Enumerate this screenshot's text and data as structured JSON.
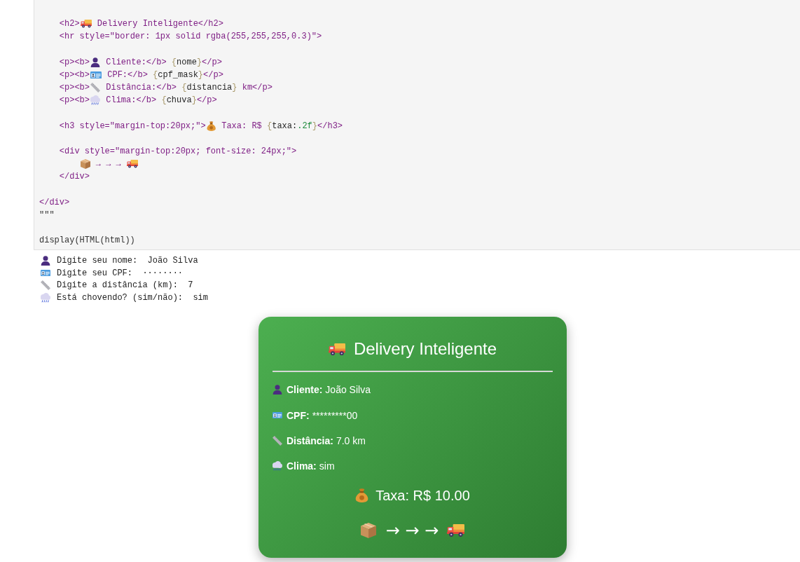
{
  "code_cell": {
    "blocks": [
      {
        "lines": [
          {
            "tokens": [
              {
                "kind": "markup",
                "text": "    <h2>"
              },
              {
                "kind": "truck"
              },
              {
                "kind": "markup",
                "text": " Delivery Inteligente</h2>"
              }
            ]
          },
          {
            "tokens": [
              {
                "kind": "markup",
                "text": "    <hr style=\"border: 1px solid rgba(255,255,255,0.3)\">"
              }
            ]
          }
        ]
      },
      {
        "lines": [
          {
            "tokens": [
              {
                "kind": "markup",
                "text": "    <p><b>"
              },
              {
                "kind": "person"
              },
              {
                "kind": "markup",
                "text": " Cliente:</b> "
              },
              {
                "kind": "brace",
                "text": "{"
              },
              {
                "kind": "name",
                "text": "nome"
              },
              {
                "kind": "brace",
                "text": "}"
              },
              {
                "kind": "markup",
                "text": "</p>"
              }
            ]
          },
          {
            "tokens": [
              {
                "kind": "markup",
                "text": "    <p><b>"
              },
              {
                "kind": "id-card"
              },
              {
                "kind": "markup",
                "text": " CPF:</b> "
              },
              {
                "kind": "brace",
                "text": "{"
              },
              {
                "kind": "name",
                "text": "cpf_mask"
              },
              {
                "kind": "brace",
                "text": "}"
              },
              {
                "kind": "markup",
                "text": "</p>"
              }
            ]
          },
          {
            "tokens": [
              {
                "kind": "markup",
                "text": "    <p><b>"
              },
              {
                "kind": "ruler"
              },
              {
                "kind": "markup",
                "text": " Distância:</b> "
              },
              {
                "kind": "brace",
                "text": "{"
              },
              {
                "kind": "name",
                "text": "distancia"
              },
              {
                "kind": "brace",
                "text": "}"
              },
              {
                "kind": "markup",
                "text": " km</p>"
              }
            ]
          },
          {
            "tokens": [
              {
                "kind": "markup",
                "text": "    <p><b>"
              },
              {
                "kind": "rain-cloud"
              },
              {
                "kind": "markup",
                "text": " Clima:</b> "
              },
              {
                "kind": "brace",
                "text": "{"
              },
              {
                "kind": "name",
                "text": "chuva"
              },
              {
                "kind": "brace",
                "text": "}"
              },
              {
                "kind": "markup",
                "text": "</p>"
              }
            ]
          }
        ]
      },
      {
        "lines": [
          {
            "tokens": [
              {
                "kind": "markup",
                "text": "    <h3 style=\"margin-top:20px;\">"
              },
              {
                "kind": "money-bag"
              },
              {
                "kind": "markup",
                "text": " Taxa: R$ "
              },
              {
                "kind": "brace",
                "text": "{"
              },
              {
                "kind": "name",
                "text": "taxa:"
              },
              {
                "kind": "format",
                "text": ".2f"
              },
              {
                "kind": "brace",
                "text": "}"
              },
              {
                "kind": "markup",
                "text": "</h3>"
              }
            ]
          }
        ]
      },
      {
        "lines": [
          {
            "tokens": [
              {
                "kind": "markup",
                "text": "    <div style=\"margin-top:20px; font-size: 24px;\">"
              }
            ],
            "children": [
              {
                "tokens": [
                  {
                    "kind": "package"
                  },
                  {
                    "kind": "markup",
                    "text": " → → → "
                  },
                  {
                    "kind": "truck"
                  }
                ]
              }
            ]
          },
          {
            "tokens": [
              {
                "kind": "markup",
                "text": "    </div>"
              }
            ]
          }
        ]
      },
      {
        "lines": [
          {
            "tokens": [
              {
                "kind": "markup",
                "text": "</div>"
              }
            ]
          },
          {
            "tokens": [
              {
                "kind": "plain",
                "text": "\"\"\""
              }
            ]
          }
        ]
      },
      {
        "lines": [
          {
            "tokens": [
              {
                "kind": "plain",
                "text": "display(HTML(html))"
              }
            ]
          }
        ]
      }
    ]
  },
  "prompts": [
    {
      "kind": "person",
      "prompt": "Digite seu nome:",
      "answer": "João Silva"
    },
    {
      "kind": "id-card",
      "prompt": "Digite seu CPF:",
      "answer": "········"
    },
    {
      "kind": "ruler",
      "prompt": "Digite a distância (km):",
      "answer": "7"
    },
    {
      "kind": "rain-cloud",
      "prompt": "Está chovendo? (sim/não):",
      "answer": "sim"
    }
  ],
  "card": {
    "title": {
      "kind": "truck",
      "text": "Delivery Inteligente"
    },
    "rows": [
      {
        "kind": "person",
        "label": "Cliente:",
        "value": "João Silva"
      },
      {
        "kind": "id-card",
        "label": "CPF:",
        "value": "*********00"
      },
      {
        "kind": "ruler",
        "label": "Distância:",
        "value": "7.0 km"
      },
      {
        "kind": "rain-cloud",
        "label": "Clima:",
        "value": "sim"
      }
    ],
    "fee": {
      "kind": "money-bag",
      "text": "Taxa: R$ 10.00"
    },
    "route": [
      {
        "kind": "package"
      },
      {
        "kind": "arrows",
        "text": "→ → →"
      },
      {
        "kind": "truck"
      }
    ]
  }
}
